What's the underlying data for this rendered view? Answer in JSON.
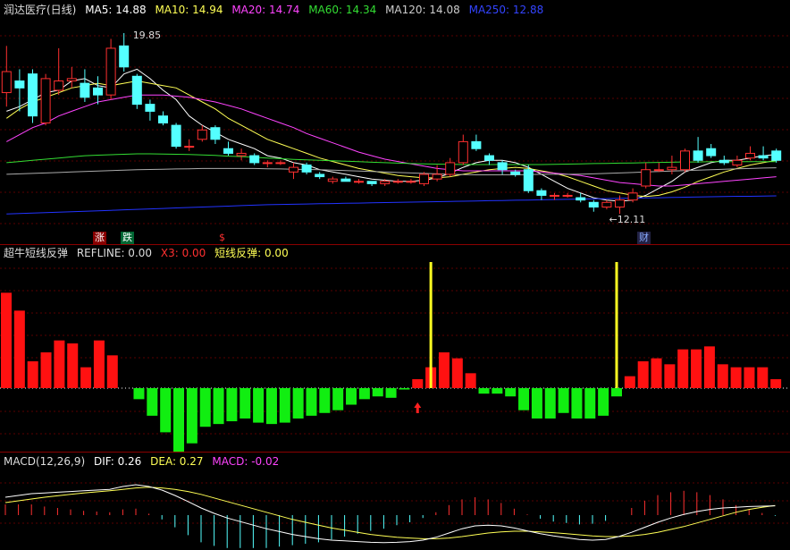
{
  "colors": {
    "up": "#ff3030",
    "down": "#54ffff",
    "ma5": "#ffffff",
    "ma10": "#ffff55",
    "ma20": "#ff44ff",
    "ma60": "#33dd33",
    "ma120": "#aaaaaa",
    "ma250": "#2233ff",
    "bar_pos": "#ff1111",
    "bar_neg": "#11ee11",
    "signal": "#ffff22",
    "dif": "#ffffff",
    "dea": "#ffff55",
    "macd": "#ff44ff"
  },
  "main_panel": {
    "title": "润达医疗(日线)",
    "ma5": "MA5: 14.88",
    "ma10": "MA10: 14.94",
    "ma20": "MA20: 14.74",
    "ma60": "MA60: 14.34",
    "ma120": "MA120: 14.08",
    "ma250": "MA250: 12.88",
    "high_label": "19.85",
    "low_label": "←12.11",
    "tag_rise": "涨",
    "tag_fall": "跌",
    "tag_dollar": "$",
    "tag_fin": "财"
  },
  "indicator_panel": {
    "title": "超牛短线反弹",
    "refline": "REFLINE: 0.00",
    "x3": "X3: 0.00",
    "signal": "短线反弹: 0.00"
  },
  "macd_panel": {
    "title": "MACD(12,26,9)",
    "dif": "DIF: 0.26",
    "dea": "DEA: 0.27",
    "macd": "MACD: -0.02"
  },
  "chart_data": [
    {
      "type": "candlestick",
      "ylim": [
        11.5,
        20.5
      ],
      "candles": [
        {
          "o": 17.3,
          "c": 18.2,
          "h": 19.3,
          "l": 16.7
        },
        {
          "o": 17.8,
          "c": 17.5,
          "h": 18.3,
          "l": 16.5
        },
        {
          "o": 18.1,
          "c": 16.3,
          "h": 18.3,
          "l": 16.0
        },
        {
          "o": 16.0,
          "c": 17.9,
          "h": 18.1,
          "l": 15.9
        },
        {
          "o": 17.4,
          "c": 17.8,
          "h": 19.2,
          "l": 17.2
        },
        {
          "o": 17.8,
          "c": 17.9,
          "h": 18.4,
          "l": 17.5
        },
        {
          "o": 17.7,
          "c": 17.1,
          "h": 18.3,
          "l": 16.9
        },
        {
          "o": 17.5,
          "c": 17.2,
          "h": 18.0,
          "l": 16.8
        },
        {
          "o": 17.2,
          "c": 19.2,
          "h": 19.6,
          "l": 17.0
        },
        {
          "o": 19.3,
          "c": 18.4,
          "h": 19.85,
          "l": 18.2
        },
        {
          "o": 18.0,
          "c": 16.8,
          "h": 18.1,
          "l": 16.6
        },
        {
          "o": 16.8,
          "c": 16.5,
          "h": 17.0,
          "l": 16.1
        },
        {
          "o": 16.3,
          "c": 16.0,
          "h": 16.5,
          "l": 15.9
        },
        {
          "o": 15.9,
          "c": 15.0,
          "h": 16.0,
          "l": 14.9
        },
        {
          "o": 15.0,
          "c": 15.0,
          "h": 15.3,
          "l": 14.8
        },
        {
          "o": 15.3,
          "c": 15.7,
          "h": 15.9,
          "l": 15.2
        },
        {
          "o": 15.8,
          "c": 15.3,
          "h": 15.9,
          "l": 15.1
        },
        {
          "o": 14.9,
          "c": 14.7,
          "h": 15.2,
          "l": 14.6
        },
        {
          "o": 14.6,
          "c": 14.7,
          "h": 14.9,
          "l": 14.4
        },
        {
          "o": 14.6,
          "c": 14.3,
          "h": 14.7,
          "l": 14.2
        },
        {
          "o": 14.3,
          "c": 14.3,
          "h": 14.4,
          "l": 14.1
        },
        {
          "o": 14.3,
          "c": 14.3,
          "h": 14.4,
          "l": 14.2
        },
        {
          "o": 13.9,
          "c": 14.1,
          "h": 14.3,
          "l": 13.6
        },
        {
          "o": 14.2,
          "c": 13.9,
          "h": 14.3,
          "l": 13.8
        },
        {
          "o": 13.8,
          "c": 13.7,
          "h": 13.9,
          "l": 13.6
        },
        {
          "o": 13.5,
          "c": 13.6,
          "h": 13.7,
          "l": 13.4
        },
        {
          "o": 13.6,
          "c": 13.5,
          "h": 13.7,
          "l": 13.5
        },
        {
          "o": 13.5,
          "c": 13.5,
          "h": 13.6,
          "l": 13.4
        },
        {
          "o": 13.5,
          "c": 13.4,
          "h": 13.5,
          "l": 13.3
        },
        {
          "o": 13.4,
          "c": 13.5,
          "h": 13.6,
          "l": 13.3
        },
        {
          "o": 13.5,
          "c": 13.5,
          "h": 13.6,
          "l": 13.4
        },
        {
          "o": 13.5,
          "c": 13.5,
          "h": 13.6,
          "l": 13.4
        },
        {
          "o": 13.4,
          "c": 13.8,
          "h": 13.9,
          "l": 13.3
        },
        {
          "o": 13.6,
          "c": 13.8,
          "h": 14.2,
          "l": 13.5
        },
        {
          "o": 13.8,
          "c": 14.3,
          "h": 14.5,
          "l": 13.7
        },
        {
          "o": 14.3,
          "c": 15.2,
          "h": 15.5,
          "l": 14.2
        },
        {
          "o": 15.2,
          "c": 14.9,
          "h": 15.5,
          "l": 14.8
        },
        {
          "o": 14.6,
          "c": 14.4,
          "h": 14.7,
          "l": 14.2
        },
        {
          "o": 14.3,
          "c": 14.0,
          "h": 14.4,
          "l": 13.8
        },
        {
          "o": 13.9,
          "c": 13.8,
          "h": 14.0,
          "l": 13.7
        },
        {
          "o": 14.0,
          "c": 13.1,
          "h": 14.2,
          "l": 13.0
        },
        {
          "o": 13.1,
          "c": 12.9,
          "h": 13.2,
          "l": 12.7
        },
        {
          "o": 12.9,
          "c": 12.9,
          "h": 13.0,
          "l": 12.7
        },
        {
          "o": 12.9,
          "c": 12.9,
          "h": 13.0,
          "l": 12.8
        },
        {
          "o": 12.8,
          "c": 12.7,
          "h": 13.0,
          "l": 12.6
        },
        {
          "o": 12.6,
          "c": 12.4,
          "h": 12.7,
          "l": 12.2
        },
        {
          "o": 12.4,
          "c": 12.6,
          "h": 12.7,
          "l": 12.3
        },
        {
          "o": 12.4,
          "c": 12.7,
          "h": 12.9,
          "l": 12.11
        },
        {
          "o": 12.7,
          "c": 13.0,
          "h": 13.2,
          "l": 12.6
        },
        {
          "o": 13.3,
          "c": 14.0,
          "h": 14.3,
          "l": 13.2
        },
        {
          "o": 14.0,
          "c": 14.0,
          "h": 14.3,
          "l": 13.9
        },
        {
          "o": 14.0,
          "c": 14.1,
          "h": 14.6,
          "l": 13.8
        },
        {
          "o": 14.0,
          "c": 14.8,
          "h": 14.9,
          "l": 13.9
        },
        {
          "o": 14.8,
          "c": 14.4,
          "h": 15.4,
          "l": 14.3
        },
        {
          "o": 14.9,
          "c": 14.6,
          "h": 15.1,
          "l": 14.5
        },
        {
          "o": 14.4,
          "c": 14.3,
          "h": 14.6,
          "l": 14.2
        },
        {
          "o": 14.2,
          "c": 14.4,
          "h": 14.6,
          "l": 14.1
        },
        {
          "o": 14.5,
          "c": 14.7,
          "h": 15.0,
          "l": 14.4
        },
        {
          "o": 14.6,
          "c": 14.5,
          "h": 15.0,
          "l": 14.4
        },
        {
          "o": 14.8,
          "c": 14.4,
          "h": 14.9,
          "l": 14.3
        }
      ],
      "ma_lines": {
        "MA5": [
          16.5,
          16.7,
          17.0,
          17.3,
          17.4,
          17.8,
          17.9,
          17.6,
          17.5,
          18.1,
          18.3,
          17.9,
          17.4,
          17.0,
          16.3,
          15.9,
          15.6,
          15.3,
          15.1,
          14.9,
          14.6,
          14.5,
          14.3,
          14.2,
          14.0,
          13.9,
          13.8,
          13.7,
          13.6,
          13.55,
          13.5,
          13.5,
          13.55,
          13.65,
          13.85,
          14.1,
          14.3,
          14.4,
          14.4,
          14.3,
          14.1,
          13.8,
          13.5,
          13.2,
          13.0,
          12.8,
          12.7,
          12.65,
          12.7,
          12.9,
          13.2,
          13.5,
          13.9,
          14.1,
          14.3,
          14.4,
          14.4,
          14.5,
          14.6,
          14.65
        ],
        "MA10": [
          16.2,
          16.6,
          16.9,
          17.1,
          17.3,
          17.5,
          17.6,
          17.7,
          17.6,
          17.7,
          17.8,
          17.7,
          17.6,
          17.5,
          17.2,
          16.9,
          16.6,
          16.2,
          15.9,
          15.6,
          15.3,
          15.1,
          14.9,
          14.7,
          14.5,
          14.35,
          14.2,
          14.05,
          13.95,
          13.85,
          13.75,
          13.7,
          13.65,
          13.65,
          13.7,
          13.8,
          13.9,
          14.0,
          14.05,
          14.1,
          14.05,
          13.95,
          13.85,
          13.7,
          13.5,
          13.3,
          13.1,
          13.0,
          12.9,
          12.85,
          12.9,
          13.05,
          13.25,
          13.5,
          13.7,
          13.9,
          14.05,
          14.2,
          14.3,
          14.4
        ],
        "MA20": [
          15.2,
          15.5,
          15.8,
          16.0,
          16.3,
          16.5,
          16.7,
          16.9,
          17.0,
          17.1,
          17.2,
          17.2,
          17.2,
          17.15,
          17.1,
          17.0,
          16.9,
          16.75,
          16.6,
          16.4,
          16.2,
          16.0,
          15.8,
          15.55,
          15.35,
          15.15,
          14.95,
          14.75,
          14.6,
          14.45,
          14.35,
          14.25,
          14.15,
          14.05,
          14.0,
          13.95,
          13.95,
          13.95,
          13.95,
          13.95,
          13.95,
          13.9,
          13.85,
          13.8,
          13.75,
          13.65,
          13.55,
          13.45,
          13.4,
          13.35,
          13.3,
          13.3,
          13.35,
          13.4,
          13.45,
          13.5,
          13.55,
          13.6,
          13.65,
          13.7
        ],
        "MA60": [
          14.3,
          14.35,
          14.4,
          14.45,
          14.5,
          14.55,
          14.6,
          14.62,
          14.64,
          14.66,
          14.68,
          14.68,
          14.67,
          14.66,
          14.65,
          14.63,
          14.61,
          14.58,
          14.56,
          14.53,
          14.5,
          14.47,
          14.44,
          14.42,
          14.4,
          14.38,
          14.36,
          14.34,
          14.32,
          14.3,
          14.28,
          14.26,
          14.25,
          14.24,
          14.23,
          14.22,
          14.22,
          14.22,
          14.22,
          14.22,
          14.22,
          14.22,
          14.23,
          14.24,
          14.25,
          14.26,
          14.27,
          14.28,
          14.29,
          14.3,
          14.31,
          14.32,
          14.33,
          14.33,
          14.34,
          14.34,
          14.34,
          14.34,
          14.34,
          14.34
        ],
        "MA120": [
          13.8,
          13.82,
          13.84,
          13.86,
          13.88,
          13.9,
          13.92,
          13.94,
          13.96,
          13.98,
          14.0,
          14.01,
          14.02,
          14.03,
          14.04,
          14.05,
          14.05,
          14.05,
          14.05,
          14.05,
          14.04,
          14.03,
          14.02,
          14.01,
          14.0,
          13.98,
          13.96,
          13.94,
          13.92,
          13.9,
          13.88,
          13.86,
          13.84,
          13.82,
          13.8,
          13.79,
          13.78,
          13.78,
          13.78,
          13.78,
          13.79,
          13.8,
          13.8,
          13.8,
          13.81,
          13.82,
          13.84,
          13.86,
          13.88,
          13.9,
          13.92,
          13.94,
          13.96,
          13.98,
          14.0,
          14.02,
          14.04,
          14.05,
          14.07,
          14.08
        ],
        "MA250": [
          12.1,
          12.12,
          12.14,
          12.16,
          12.18,
          12.2,
          12.22,
          12.24,
          12.26,
          12.28,
          12.3,
          12.32,
          12.34,
          12.36,
          12.38,
          12.4,
          12.42,
          12.44,
          12.46,
          12.48,
          12.5,
          12.51,
          12.52,
          12.53,
          12.54,
          12.55,
          12.56,
          12.57,
          12.58,
          12.59,
          12.6,
          12.61,
          12.62,
          12.63,
          12.64,
          12.65,
          12.66,
          12.67,
          12.68,
          12.69,
          12.7,
          12.71,
          12.72,
          12.73,
          12.74,
          12.75,
          12.76,
          12.77,
          12.78,
          12.79,
          12.8,
          12.81,
          12.82,
          12.83,
          12.84,
          12.85,
          12.86,
          12.86,
          12.87,
          12.88
        ]
      }
    },
    {
      "type": "bar",
      "ylim": [
        -2.3,
        3.0
      ],
      "values": [
        3.2,
        2.6,
        0.9,
        1.2,
        1.6,
        1.5,
        0.7,
        1.6,
        1.1,
        0,
        -0.4,
        -1.0,
        -1.6,
        -2.3,
        -2.0,
        -1.4,
        -1.3,
        -1.2,
        -1.1,
        -1.25,
        -1.3,
        -1.25,
        -1.1,
        -1.0,
        -0.9,
        -0.8,
        -0.6,
        -0.4,
        -0.3,
        -0.35,
        -0.05,
        0.3,
        0.7,
        1.2,
        1.0,
        0.5,
        -0.2,
        -0.2,
        -0.3,
        -0.8,
        -1.1,
        -1.1,
        -0.9,
        -1.1,
        -1.1,
        -1.0,
        -0.3,
        0.4,
        0.9,
        1.0,
        0.8,
        1.3,
        1.3,
        1.4,
        0.8,
        0.7,
        0.7,
        0.7,
        0.3
      ],
      "signals_at": [
        32,
        46
      ],
      "arrow_at": 31
    },
    {
      "type": "macd",
      "ylim": [
        -1.0,
        1.0
      ],
      "dif": [
        0.5,
        0.55,
        0.6,
        0.62,
        0.64,
        0.66,
        0.68,
        0.7,
        0.72,
        0.8,
        0.85,
        0.8,
        0.7,
        0.55,
        0.38,
        0.2,
        0.05,
        -0.08,
        -0.18,
        -0.28,
        -0.38,
        -0.46,
        -0.54,
        -0.6,
        -0.66,
        -0.7,
        -0.72,
        -0.74,
        -0.76,
        -0.77,
        -0.76,
        -0.74,
        -0.7,
        -0.62,
        -0.5,
        -0.38,
        -0.3,
        -0.28,
        -0.3,
        -0.36,
        -0.44,
        -0.52,
        -0.58,
        -0.63,
        -0.68,
        -0.7,
        -0.68,
        -0.6,
        -0.48,
        -0.34,
        -0.2,
        -0.08,
        0.02,
        0.1,
        0.16,
        0.2,
        0.22,
        0.24,
        0.25,
        0.26
      ],
      "dea": [
        0.35,
        0.4,
        0.45,
        0.5,
        0.54,
        0.58,
        0.62,
        0.65,
        0.68,
        0.72,
        0.76,
        0.78,
        0.76,
        0.72,
        0.66,
        0.58,
        0.48,
        0.38,
        0.28,
        0.18,
        0.08,
        -0.02,
        -0.12,
        -0.2,
        -0.28,
        -0.36,
        -0.42,
        -0.48,
        -0.54,
        -0.58,
        -0.62,
        -0.64,
        -0.66,
        -0.66,
        -0.64,
        -0.6,
        -0.55,
        -0.5,
        -0.47,
        -0.45,
        -0.45,
        -0.47,
        -0.49,
        -0.52,
        -0.55,
        -0.58,
        -0.6,
        -0.6,
        -0.58,
        -0.54,
        -0.48,
        -0.4,
        -0.32,
        -0.22,
        -0.12,
        -0.02,
        0.08,
        0.16,
        0.22,
        0.27
      ],
      "macd": [
        0.3,
        0.3,
        0.3,
        0.24,
        0.2,
        0.16,
        0.12,
        0.1,
        0.08,
        0.16,
        0.18,
        0.04,
        -0.12,
        -0.34,
        -0.56,
        -0.76,
        -0.86,
        -0.92,
        -0.92,
        -0.92,
        -0.92,
        -0.88,
        -0.84,
        -0.8,
        -0.76,
        -0.68,
        -0.6,
        -0.52,
        -0.44,
        -0.38,
        -0.28,
        -0.2,
        -0.08,
        0.08,
        0.28,
        0.44,
        0.5,
        0.44,
        0.34,
        0.18,
        0.02,
        -0.1,
        -0.18,
        -0.22,
        -0.26,
        -0.24,
        -0.16,
        0.0,
        0.2,
        0.4,
        0.56,
        0.64,
        0.68,
        0.64,
        0.56,
        0.44,
        0.28,
        0.16,
        0.06,
        -0.02
      ]
    }
  ]
}
